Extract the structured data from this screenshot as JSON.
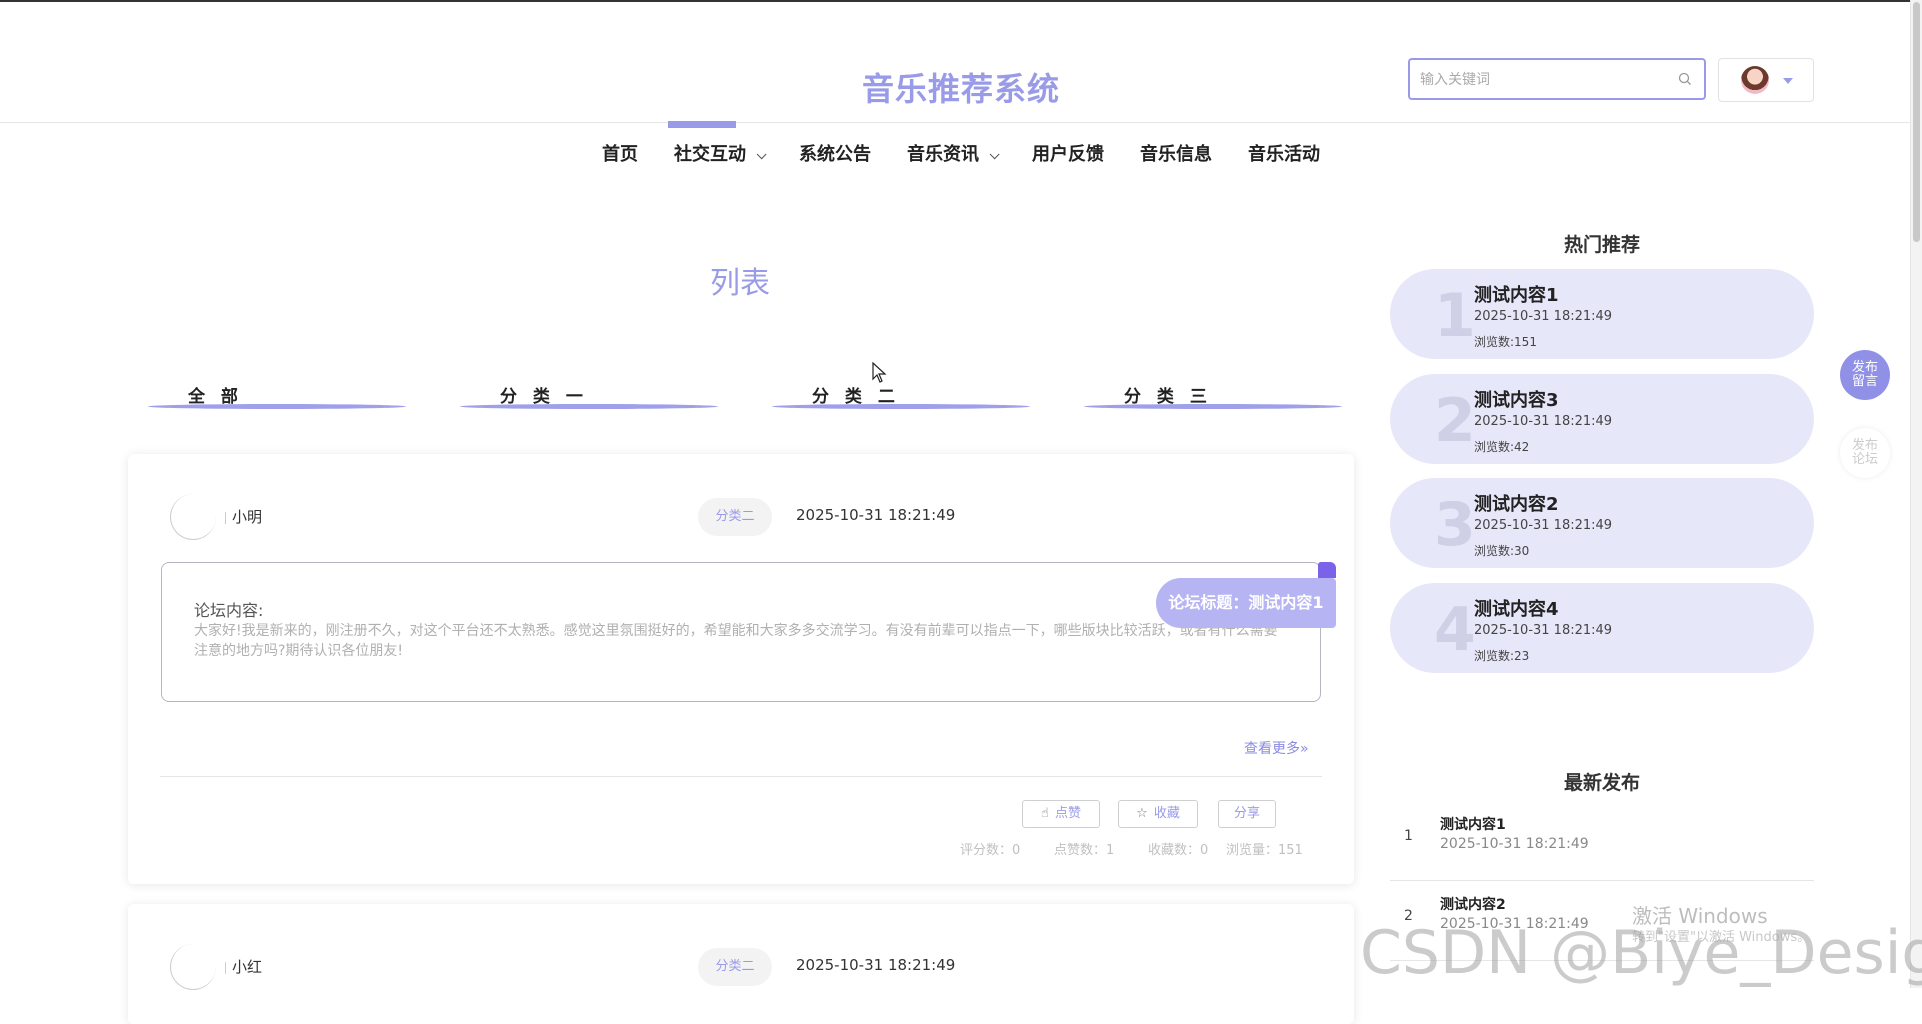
{
  "site": {
    "title": "音乐推荐系统"
  },
  "search": {
    "placeholder": "输入关键词"
  },
  "nav": [
    {
      "label": "首页",
      "dropdown": false
    },
    {
      "label": "社交互动",
      "dropdown": true,
      "active": true
    },
    {
      "label": "系统公告",
      "dropdown": false
    },
    {
      "label": "音乐资讯",
      "dropdown": true
    },
    {
      "label": "用户反馈",
      "dropdown": false
    },
    {
      "label": "音乐信息",
      "dropdown": false
    },
    {
      "label": "音乐活动",
      "dropdown": false
    }
  ],
  "page": {
    "title": "列表"
  },
  "categories": [
    "全 部",
    "分 类 一",
    "分 类 二",
    "分 类 三"
  ],
  "posts": [
    {
      "username": "小明",
      "category": "分类二",
      "time": "2025-10-31 18:21:49",
      "content_label": "论坛内容:",
      "content": "大家好!我是新来的，刚注册不久，对这个平台还不太熟悉。感觉这里氛围挺好的，希望能和大家多多交流学习。有没有前辈可以指点一下，哪些版块比较活跃，或者有什么需要注意的地方吗?期待认识各位朋友!",
      "title_label": "论坛标题：测试内容1",
      "more": "查看更多»",
      "actions": {
        "like": "点赞",
        "favorite": "收藏",
        "share": "分享"
      },
      "stats": {
        "score": "评分数：0",
        "likes": "点赞数：1",
        "favorites": "收藏数：0",
        "views": "浏览量：151"
      }
    },
    {
      "username": "小红",
      "category": "分类二",
      "time": "2025-10-31 18:21:49"
    }
  ],
  "hot": {
    "heading": "热门推荐",
    "items": [
      {
        "rank": "1",
        "title": "测试内容1",
        "date": "2025-10-31 18:21:49",
        "views": "浏览数:151"
      },
      {
        "rank": "2",
        "title": "测试内容3",
        "date": "2025-10-31 18:21:49",
        "views": "浏览数:42"
      },
      {
        "rank": "3",
        "title": "测试内容2",
        "date": "2025-10-31 18:21:49",
        "views": "浏览数:30"
      },
      {
        "rank": "4",
        "title": "测试内容4",
        "date": "2025-10-31 18:21:49",
        "views": "浏览数:23"
      }
    ]
  },
  "latest": {
    "heading": "最新发布",
    "items": [
      {
        "rank": "1",
        "title": "测试内容1",
        "date": "2025-10-31 18:21:49"
      },
      {
        "rank": "2",
        "title": "测试内容2",
        "date": "2025-10-31 18:21:49"
      }
    ]
  },
  "float_buttons": {
    "post_message": "发布\n留言",
    "post_forum": "发布\n论坛"
  },
  "watermarks": {
    "windows": "激活 Windows",
    "windows_sub": "转到\"设置\"以激活 Windows。",
    "csdn": "CSDN @Biye_Design"
  },
  "colors": {
    "accent": "#9a9be8",
    "hot_bg": "#e7e7fa",
    "ribbon": "#b6b4f3"
  }
}
